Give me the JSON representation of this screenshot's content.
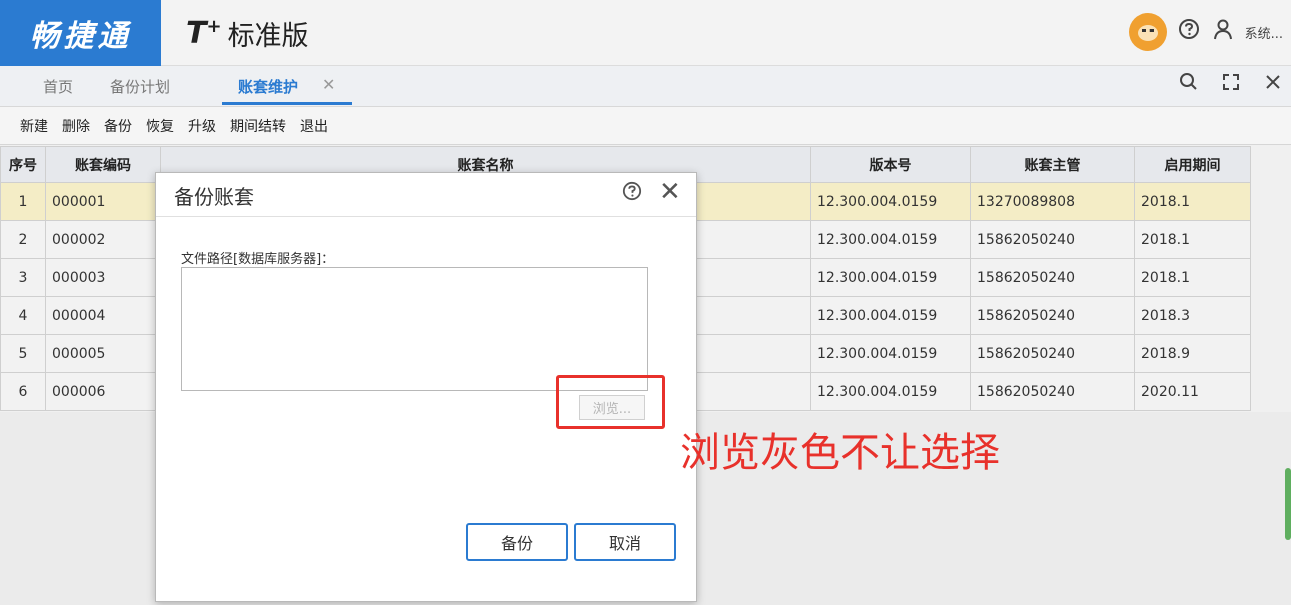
{
  "header": {
    "brand": "畅捷通",
    "product_logo": "T",
    "product_logo_sup": "+",
    "product_name": "标准版",
    "icons": [
      "mascot-icon",
      "help-icon",
      "user-icon"
    ],
    "user_label": "系统..."
  },
  "tabs": {
    "items": [
      {
        "label": "首页"
      },
      {
        "label": "备份计划"
      },
      {
        "label": "账套维护"
      }
    ],
    "active_index": 2,
    "close_glyph": "✕",
    "tools": [
      "search-icon",
      "fullscreen-icon",
      "close-icon"
    ]
  },
  "toolbar": {
    "buttons": [
      "新建",
      "删除",
      "备份",
      "恢复",
      "升级",
      "期间结转",
      "退出"
    ]
  },
  "table": {
    "columns": [
      "序号",
      "账套编码",
      "账套名称",
      "版本号",
      "账套主管",
      "启用期间"
    ],
    "rows": [
      {
        "no": "1",
        "code": "000001",
        "name": "",
        "version": "12.300.004.0159",
        "manager": "13270089808",
        "period": "2018.1"
      },
      {
        "no": "2",
        "code": "000002",
        "name": "",
        "version": "12.300.004.0159",
        "manager": "15862050240",
        "period": "2018.1"
      },
      {
        "no": "3",
        "code": "000003",
        "name": "",
        "version": "12.300.004.0159",
        "manager": "15862050240",
        "period": "2018.1"
      },
      {
        "no": "4",
        "code": "000004",
        "name": "",
        "version": "12.300.004.0159",
        "manager": "15862050240",
        "period": "2018.3"
      },
      {
        "no": "5",
        "code": "000005",
        "name": "",
        "version": "12.300.004.0159",
        "manager": "15862050240",
        "period": "2018.9"
      },
      {
        "no": "6",
        "code": "000006",
        "name": "",
        "version": "12.300.004.0159",
        "manager": "15862050240",
        "period": "2020.11"
      }
    ],
    "selected_row": 0
  },
  "dialog": {
    "title": "备份账套",
    "help_glyph": "?",
    "close_glyph": "✕",
    "path_label": "文件路径[数据库服务器]：",
    "path_value": "",
    "browse_label": "浏览...",
    "ok_label": "备份",
    "cancel_label": "取消"
  },
  "annotation": {
    "note": "浏览灰色不让选择",
    "color": "#e8312b"
  },
  "colors": {
    "accent": "#2b7bd1",
    "selected_row": "#f4edc6"
  }
}
